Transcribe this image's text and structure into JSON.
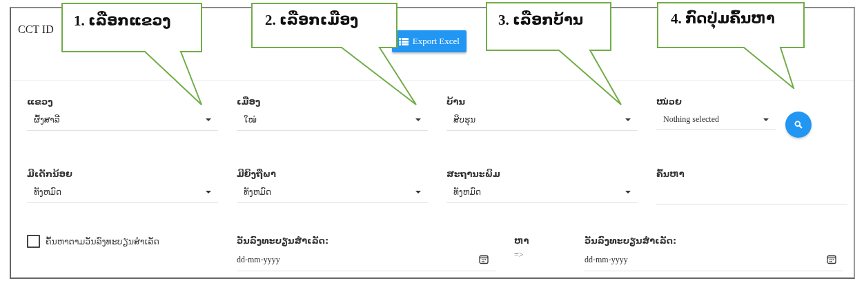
{
  "header": {
    "title": "CCT ID",
    "export_button": "Export Excel"
  },
  "filters": [
    {
      "kind": "select",
      "label": "ແຂວງ",
      "value": "ຜົ້ງສາລີ"
    },
    {
      "kind": "select",
      "label": "ເມືອງ",
      "value": "ໃໝ່"
    },
    {
      "kind": "select",
      "label": "ບ້ານ",
      "value": "ສິບຮຸນ"
    },
    {
      "kind": "select",
      "label": "ໜ່ວຍ",
      "value": "Nothing selected"
    },
    {
      "kind": "select",
      "label": "ມີເດັກນ້ອຍ",
      "value": "ທັງຫມົດ"
    },
    {
      "kind": "select",
      "label": "ມີຍິງຖືພາ",
      "value": "ທັງຫມົດ"
    },
    {
      "kind": "select",
      "label": "ສະຖານະພິມ",
      "value": "ທັງຫມົດ"
    },
    {
      "kind": "text",
      "label": "ຄົ້ນຫາ"
    }
  ],
  "date_filter": {
    "checkbox_label": "ຄົ້ນຫາຕາມວັນລົງທະບຽນສຳເລັດ",
    "checked": false,
    "from_label": "ວັນລົງທະບຽນສຳເລັດ:",
    "from_placeholder": "dd-mm-yyyy",
    "separator_label": "ຫາ",
    "separator_arrow": "=>",
    "to_label": "ວັນລົງທະບຽນສຳເລັດ:",
    "to_placeholder": "dd-mm-yyyy"
  },
  "callouts": [
    {
      "text": "1. ເລືອກແຂວງ"
    },
    {
      "text": "2. ເລືອກເມືອງ"
    },
    {
      "text": "3. ເລືອກບ້ານ"
    },
    {
      "text": "4. ກົດປຸ່ມຄົ້ນຫາ"
    }
  ]
}
